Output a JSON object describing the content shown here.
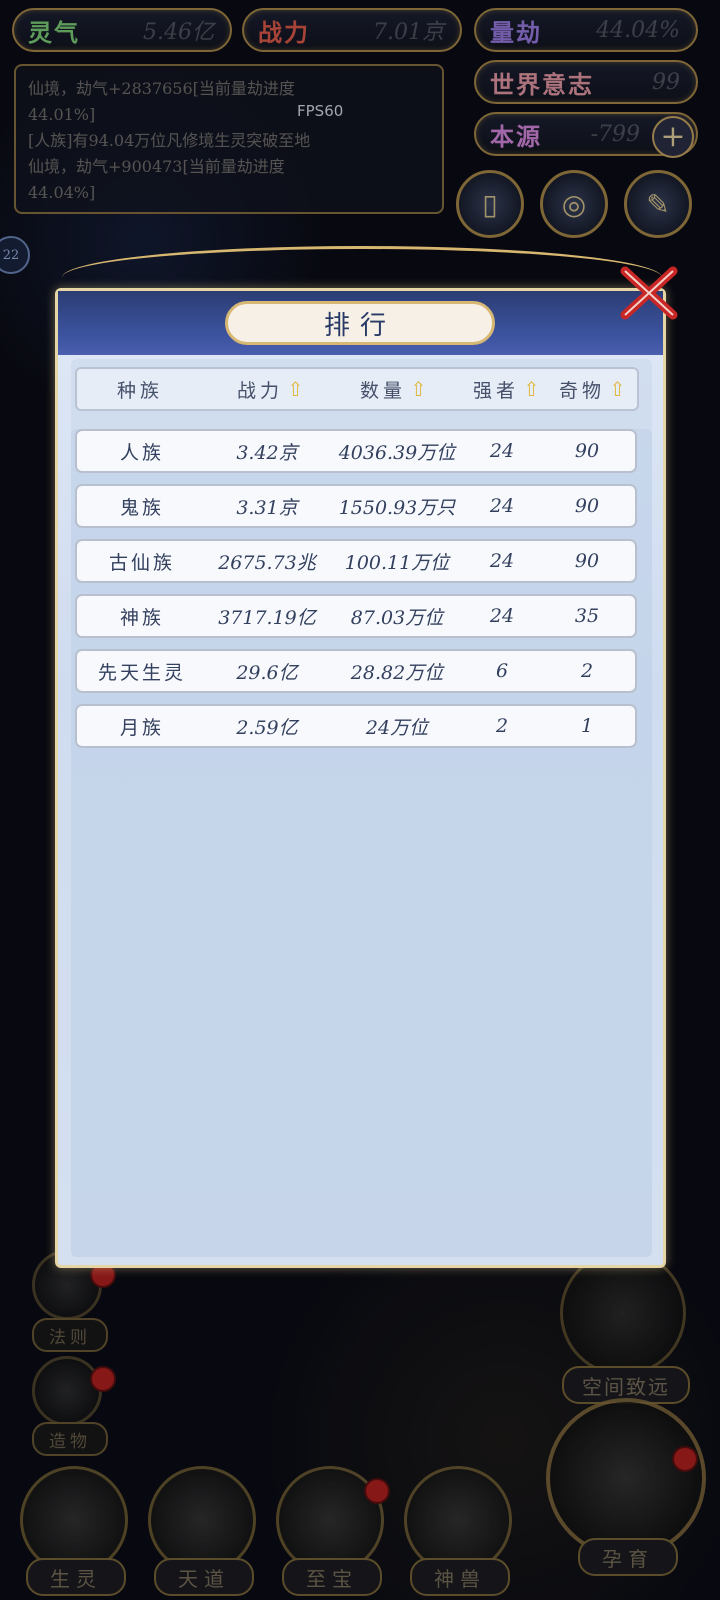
{
  "hud": {
    "lingqi": {
      "label": "灵气",
      "value": "5.46亿"
    },
    "zhanli": {
      "label": "战力",
      "value": "7.01京"
    },
    "liangjie": {
      "label": "量劫",
      "value": "44.04%"
    },
    "shijie": {
      "label": "世界意志",
      "value": "99"
    },
    "benyuan": {
      "label": "本源",
      "value": "-799"
    },
    "plus": "+",
    "fps": "FPS60",
    "side_badge": "22",
    "log_lines": [
      "仙境，劫气+2837656[当前量劫进度",
      "44.01%]",
      "[人族]有94.04万位凡修境生灵突破至地",
      "仙境，劫气+900473[当前量劫进度",
      "44.04%]"
    ]
  },
  "dialog": {
    "title": "排行",
    "headers": [
      {
        "label": "种族",
        "sortable": false
      },
      {
        "label": "战力",
        "sortable": true
      },
      {
        "label": "数量",
        "sortable": true
      },
      {
        "label": "强者",
        "sortable": true
      },
      {
        "label": "奇物",
        "sortable": true
      }
    ],
    "rows": [
      {
        "race": "人族",
        "power": "3.42京",
        "count": "4036.39万位",
        "strong": "24",
        "items": "90"
      },
      {
        "race": "鬼族",
        "power": "3.31京",
        "count": "1550.93万只",
        "strong": "24",
        "items": "90"
      },
      {
        "race": "古仙族",
        "power": "2675.73兆",
        "count": "100.11万位",
        "strong": "24",
        "items": "90"
      },
      {
        "race": "神族",
        "power": "3717.19亿",
        "count": "87.03万位",
        "strong": "24",
        "items": "35"
      },
      {
        "race": "先天生灵",
        "power": "29.6亿",
        "count": "28.82万位",
        "strong": "6",
        "items": "2"
      },
      {
        "race": "月族",
        "power": "2.59亿",
        "count": "24万位",
        "strong": "2",
        "items": "1"
      }
    ]
  },
  "menu": {
    "side": [
      "法则",
      "造物"
    ],
    "bottom": [
      "生灵",
      "天道",
      "至宝",
      "神兽"
    ],
    "big": [
      "空间致远",
      "孕育"
    ]
  },
  "colors": {
    "accent": "#d8b870",
    "header_blue": "#3c53a0",
    "sort_arrow": "#e2b73e"
  }
}
